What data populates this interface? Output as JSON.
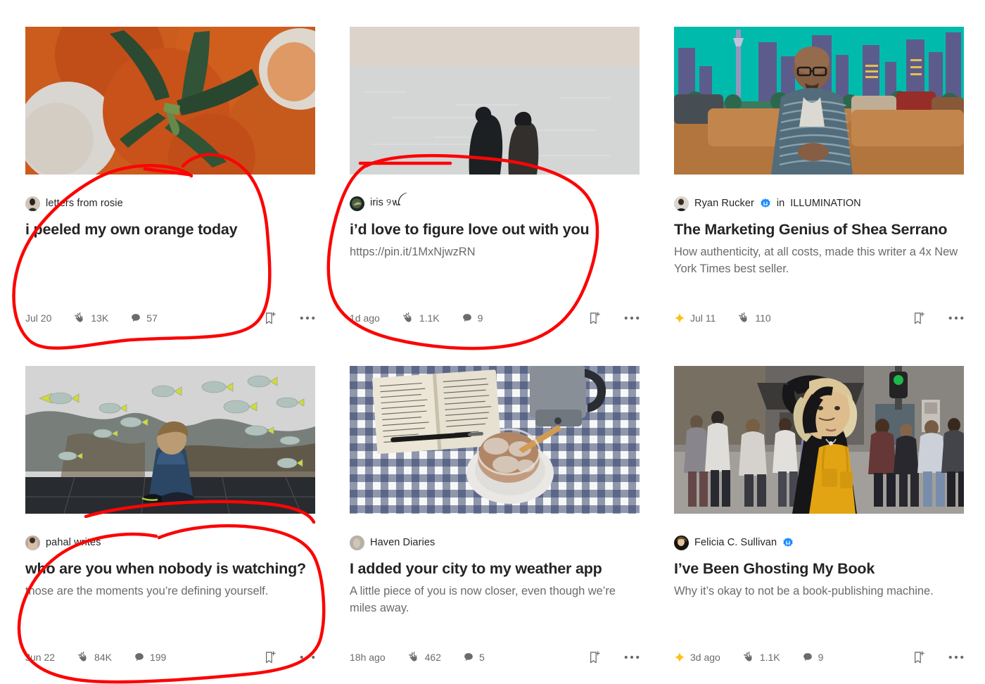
{
  "app": {
    "name": "medium-feed",
    "accent_color": "#242424",
    "muted_color": "#6b6b6b",
    "verified_badge_color": "#1a8cff",
    "star_color": "#ffc017",
    "annotation_color": "#ff0000"
  },
  "icons": {
    "clap": "clap-icon",
    "comment": "comment-bubble-icon",
    "bookmark": "bookmark-plus-icon",
    "more": "more-options-icon",
    "star": "member-star-icon",
    "verified": "verified-badge-icon"
  },
  "cards": [
    {
      "id": "card-orange",
      "author": "letters from rosie",
      "verified": false,
      "in_label": "",
      "publication": "",
      "title": "i peeled my own orange today",
      "subtitle": "",
      "member_star": false,
      "date": "Jul 20",
      "claps": "13K",
      "comments": "57",
      "image_alt": "oranges-with-leaves-image",
      "annotated": true
    },
    {
      "id": "card-ocean",
      "author": "iris ୨ꪡ",
      "verified": false,
      "in_label": "",
      "publication": "",
      "title": "i’d love to figure love out with you",
      "subtitle": "https://pin.it/1MxNjwzRN",
      "member_star": false,
      "date": "1d ago",
      "claps": "1.1K",
      "comments": "9",
      "image_alt": "two-people-watching-ocean-image",
      "annotated": true
    },
    {
      "id": "card-serrano",
      "author": "Ryan Rucker",
      "verified": true,
      "in_label": "in",
      "publication": "ILLUMINATION",
      "title": "The Marketing Genius of Shea Serrano",
      "subtitle": "How authenticity, at all costs, made this writer a 4x New York Times best seller.",
      "member_star": true,
      "date": "Jul 11",
      "claps": "110",
      "comments": "",
      "image_alt": "man-on-couch-city-skyline-image",
      "annotated": false
    },
    {
      "id": "card-aquarium",
      "author": "pahal writes",
      "verified": false,
      "in_label": "",
      "publication": "",
      "title": "who are you when nobody is watching?",
      "subtitle": "those are the moments you’re defining yourself.",
      "member_star": false,
      "date": "Jun 22",
      "claps": "84K",
      "comments": "199",
      "image_alt": "boy-at-aquarium-image",
      "annotated": true
    },
    {
      "id": "card-weather",
      "author": "Haven Diaries",
      "verified": false,
      "in_label": "",
      "publication": "",
      "title": "I added your city to my weather app",
      "subtitle": "A little piece of you is now closer, even though we’re miles away.",
      "member_star": false,
      "date": "18h ago",
      "claps": "462",
      "comments": "5",
      "image_alt": "journal-pen-iced-coffee-image",
      "annotated": false
    },
    {
      "id": "card-ghosting",
      "author": "Felicia C. Sullivan",
      "verified": true,
      "in_label": "",
      "publication": "",
      "title": "I’ve Been Ghosting My Book",
      "subtitle": "Why it’s okay to not be a book-publishing machine.",
      "member_star": true,
      "date": "3d ago",
      "claps": "1.1K",
      "comments": "9",
      "image_alt": "woman-in-yellow-overalls-street-image",
      "annotated": false
    }
  ]
}
